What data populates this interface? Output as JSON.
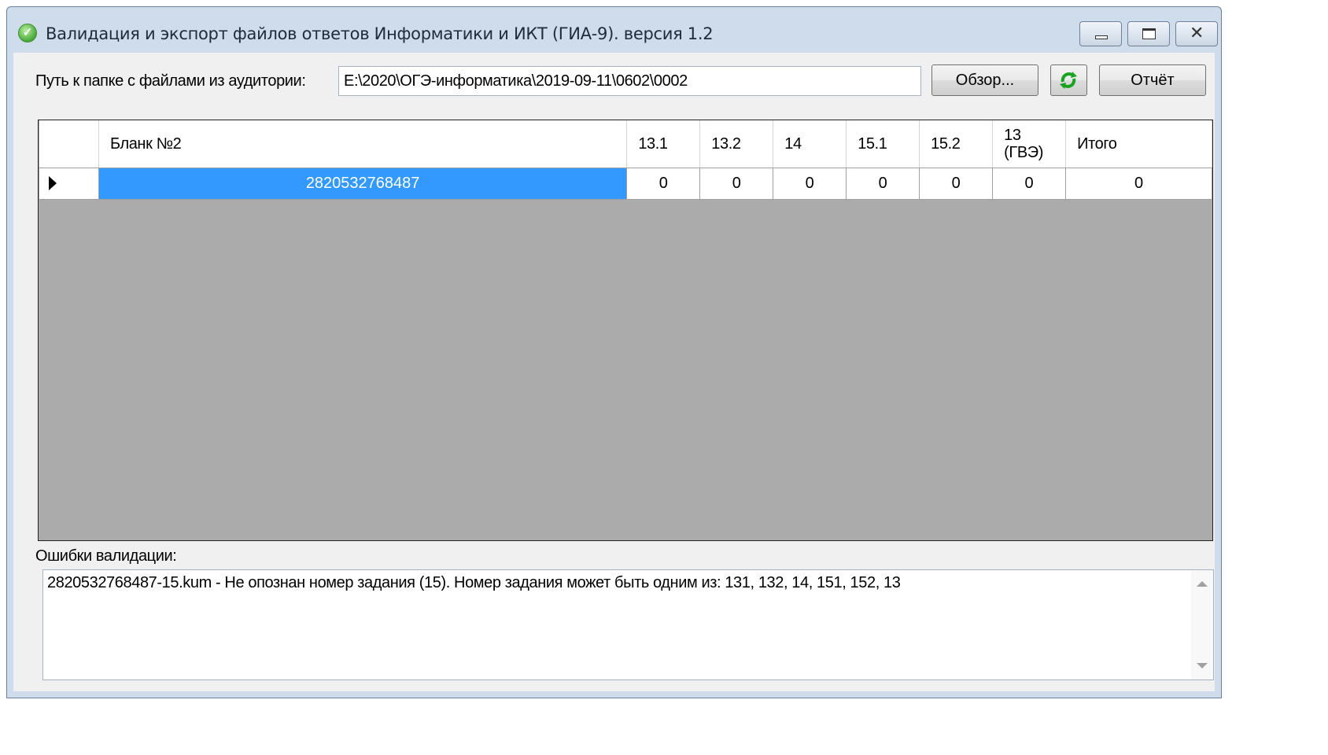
{
  "window": {
    "title": "Валидация и экспорт файлов ответов Информатики и ИКТ (ГИА-9). версия 1.2"
  },
  "path": {
    "label": "Путь к папке с файлами из аудитории:",
    "value": "E:\\2020\\ОГЭ-информатика\\2019-09-11\\0602\\0002",
    "browse_label": "Обзор...",
    "refresh_icon": "refresh-icon",
    "report_label": "Отчёт"
  },
  "grid": {
    "columns": [
      "Бланк №2",
      "13.1",
      "13.2",
      "14",
      "15.1",
      "15.2",
      "13 (ГВЭ)",
      "Итого"
    ],
    "rows": [
      {
        "blank": "2820532768487",
        "c131": "0",
        "c132": "0",
        "c14": "0",
        "c151": "0",
        "c152": "0",
        "c13gve": "0",
        "total": "0"
      }
    ]
  },
  "errors": {
    "label": "Ошибки валидации:",
    "text": "2820532768487-15.kum - Не опознан номер задания (15). Номер задания может быть одним из: 131, 132, 14, 151, 152, 13"
  },
  "colors": {
    "selection": "#3399ff",
    "grid_background": "#ababab",
    "window_frame": "#cfdceb"
  }
}
